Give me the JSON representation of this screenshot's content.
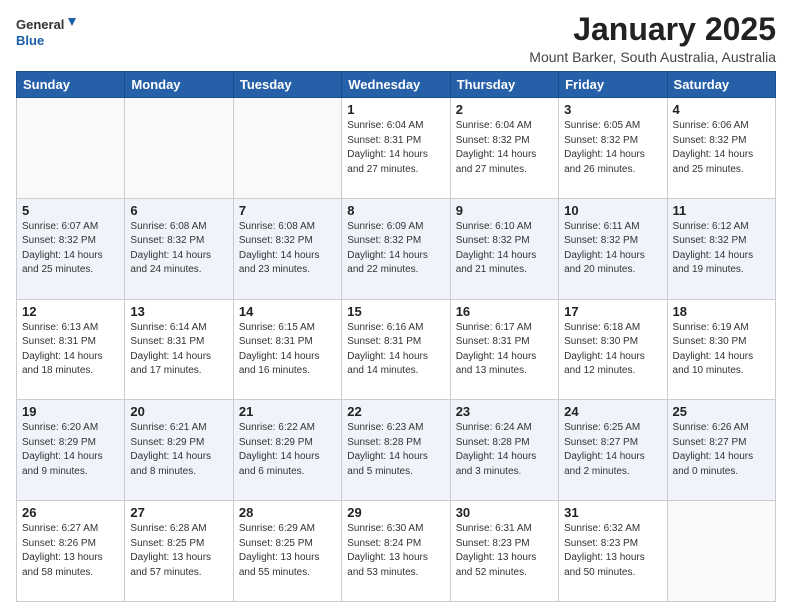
{
  "logo": {
    "text_general": "General",
    "text_blue": "Blue"
  },
  "header": {
    "month_title": "January 2025",
    "location": "Mount Barker, South Australia, Australia"
  },
  "weekdays": [
    "Sunday",
    "Monday",
    "Tuesday",
    "Wednesday",
    "Thursday",
    "Friday",
    "Saturday"
  ],
  "weeks": [
    [
      {
        "day": "",
        "info": ""
      },
      {
        "day": "",
        "info": ""
      },
      {
        "day": "",
        "info": ""
      },
      {
        "day": "1",
        "info": "Sunrise: 6:04 AM\nSunset: 8:31 PM\nDaylight: 14 hours\nand 27 minutes."
      },
      {
        "day": "2",
        "info": "Sunrise: 6:04 AM\nSunset: 8:32 PM\nDaylight: 14 hours\nand 27 minutes."
      },
      {
        "day": "3",
        "info": "Sunrise: 6:05 AM\nSunset: 8:32 PM\nDaylight: 14 hours\nand 26 minutes."
      },
      {
        "day": "4",
        "info": "Sunrise: 6:06 AM\nSunset: 8:32 PM\nDaylight: 14 hours\nand 25 minutes."
      }
    ],
    [
      {
        "day": "5",
        "info": "Sunrise: 6:07 AM\nSunset: 8:32 PM\nDaylight: 14 hours\nand 25 minutes."
      },
      {
        "day": "6",
        "info": "Sunrise: 6:08 AM\nSunset: 8:32 PM\nDaylight: 14 hours\nand 24 minutes."
      },
      {
        "day": "7",
        "info": "Sunrise: 6:08 AM\nSunset: 8:32 PM\nDaylight: 14 hours\nand 23 minutes."
      },
      {
        "day": "8",
        "info": "Sunrise: 6:09 AM\nSunset: 8:32 PM\nDaylight: 14 hours\nand 22 minutes."
      },
      {
        "day": "9",
        "info": "Sunrise: 6:10 AM\nSunset: 8:32 PM\nDaylight: 14 hours\nand 21 minutes."
      },
      {
        "day": "10",
        "info": "Sunrise: 6:11 AM\nSunset: 8:32 PM\nDaylight: 14 hours\nand 20 minutes."
      },
      {
        "day": "11",
        "info": "Sunrise: 6:12 AM\nSunset: 8:32 PM\nDaylight: 14 hours\nand 19 minutes."
      }
    ],
    [
      {
        "day": "12",
        "info": "Sunrise: 6:13 AM\nSunset: 8:31 PM\nDaylight: 14 hours\nand 18 minutes."
      },
      {
        "day": "13",
        "info": "Sunrise: 6:14 AM\nSunset: 8:31 PM\nDaylight: 14 hours\nand 17 minutes."
      },
      {
        "day": "14",
        "info": "Sunrise: 6:15 AM\nSunset: 8:31 PM\nDaylight: 14 hours\nand 16 minutes."
      },
      {
        "day": "15",
        "info": "Sunrise: 6:16 AM\nSunset: 8:31 PM\nDaylight: 14 hours\nand 14 minutes."
      },
      {
        "day": "16",
        "info": "Sunrise: 6:17 AM\nSunset: 8:31 PM\nDaylight: 14 hours\nand 13 minutes."
      },
      {
        "day": "17",
        "info": "Sunrise: 6:18 AM\nSunset: 8:30 PM\nDaylight: 14 hours\nand 12 minutes."
      },
      {
        "day": "18",
        "info": "Sunrise: 6:19 AM\nSunset: 8:30 PM\nDaylight: 14 hours\nand 10 minutes."
      }
    ],
    [
      {
        "day": "19",
        "info": "Sunrise: 6:20 AM\nSunset: 8:29 PM\nDaylight: 14 hours\nand 9 minutes."
      },
      {
        "day": "20",
        "info": "Sunrise: 6:21 AM\nSunset: 8:29 PM\nDaylight: 14 hours\nand 8 minutes."
      },
      {
        "day": "21",
        "info": "Sunrise: 6:22 AM\nSunset: 8:29 PM\nDaylight: 14 hours\nand 6 minutes."
      },
      {
        "day": "22",
        "info": "Sunrise: 6:23 AM\nSunset: 8:28 PM\nDaylight: 14 hours\nand 5 minutes."
      },
      {
        "day": "23",
        "info": "Sunrise: 6:24 AM\nSunset: 8:28 PM\nDaylight: 14 hours\nand 3 minutes."
      },
      {
        "day": "24",
        "info": "Sunrise: 6:25 AM\nSunset: 8:27 PM\nDaylight: 14 hours\nand 2 minutes."
      },
      {
        "day": "25",
        "info": "Sunrise: 6:26 AM\nSunset: 8:27 PM\nDaylight: 14 hours\nand 0 minutes."
      }
    ],
    [
      {
        "day": "26",
        "info": "Sunrise: 6:27 AM\nSunset: 8:26 PM\nDaylight: 13 hours\nand 58 minutes."
      },
      {
        "day": "27",
        "info": "Sunrise: 6:28 AM\nSunset: 8:25 PM\nDaylight: 13 hours\nand 57 minutes."
      },
      {
        "day": "28",
        "info": "Sunrise: 6:29 AM\nSunset: 8:25 PM\nDaylight: 13 hours\nand 55 minutes."
      },
      {
        "day": "29",
        "info": "Sunrise: 6:30 AM\nSunset: 8:24 PM\nDaylight: 13 hours\nand 53 minutes."
      },
      {
        "day": "30",
        "info": "Sunrise: 6:31 AM\nSunset: 8:23 PM\nDaylight: 13 hours\nand 52 minutes."
      },
      {
        "day": "31",
        "info": "Sunrise: 6:32 AM\nSunset: 8:23 PM\nDaylight: 13 hours\nand 50 minutes."
      },
      {
        "day": "",
        "info": ""
      }
    ]
  ]
}
